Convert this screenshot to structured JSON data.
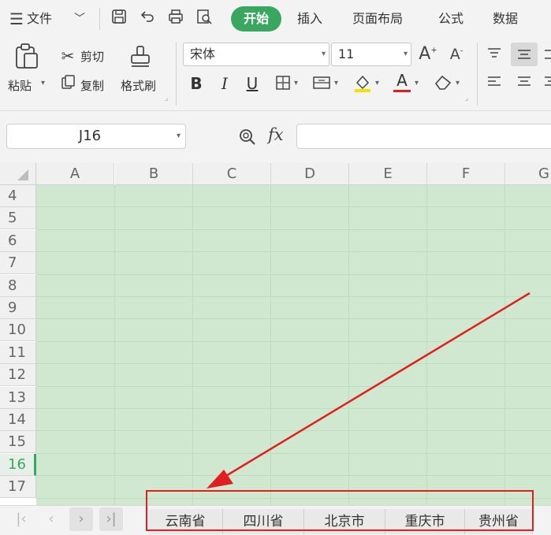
{
  "menu": {
    "file_label": "文件",
    "tabs": [
      "开始",
      "插入",
      "页面布局",
      "公式",
      "数据"
    ],
    "active_tab": "开始"
  },
  "ribbon": {
    "paste_label": "粘贴",
    "cut_label": "剪切",
    "copy_label": "复制",
    "format_painter_label": "格式刷",
    "font_name": "宋体",
    "font_size": "11",
    "bold_label": "B",
    "italic_label": "I",
    "underline_label": "U",
    "font_color_label": "A",
    "grow_font_label": "A",
    "shrink_font_label": "A"
  },
  "formula_bar": {
    "name_box": "J16",
    "fx_label": "fx",
    "formula_value": ""
  },
  "grid": {
    "columns": [
      "A",
      "B",
      "C",
      "D",
      "E",
      "F",
      "G"
    ],
    "rows": [
      "4",
      "5",
      "6",
      "7",
      "8",
      "9",
      "10",
      "11",
      "12",
      "13",
      "14",
      "15",
      "16",
      "17"
    ],
    "selected_row": "16"
  },
  "sheets": {
    "tabs": [
      "云南省",
      "四川省",
      "北京市",
      "重庆市",
      "贵州省"
    ]
  },
  "colors": {
    "accent": "#3aa760",
    "cell_fill": "#cfe8cf",
    "annotation": "#e02020"
  }
}
